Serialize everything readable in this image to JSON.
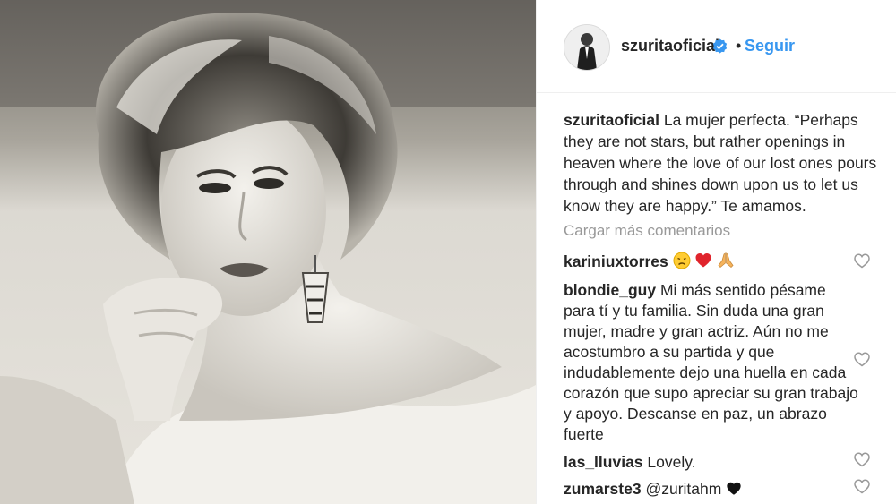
{
  "post": {
    "username": "szuritaoficial",
    "separator": "•",
    "follow_label": "Seguir",
    "caption_text": "La mujer perfecta. “Perhaps they are not stars, but rather openings in heaven where the love of our lost ones pours through and shines down upon us to let us know they are happy.” Te amamos.",
    "load_more_label": "Cargar más comentarios"
  },
  "comments": [
    {
      "username": "kariniuxtorres",
      "text": "",
      "emojis": [
        "disappointed-face-icon",
        "red-heart-icon",
        "folded-hands-icon"
      ]
    },
    {
      "username": "blondie_guy",
      "text": "Mi más sentido pésame para tí y tu familia. Sin duda una gran mujer, madre y gran actriz. Aún no me acostumbro a su partida y que indudablemente dejo una huella en cada corazón que supo apreciar su gran trabajo y apoyo. Descanse en paz, un abrazo fuerte"
    },
    {
      "username": "las_lluvias",
      "text": "Lovely."
    },
    {
      "username": "zumarste3",
      "text": "@zuritahm",
      "emojis": [
        "black-heart-icon"
      ]
    }
  ],
  "colors": {
    "link_blue": "#3897f0",
    "text": "#262626",
    "muted": "#999999",
    "verified_blue": "#3897f0"
  }
}
